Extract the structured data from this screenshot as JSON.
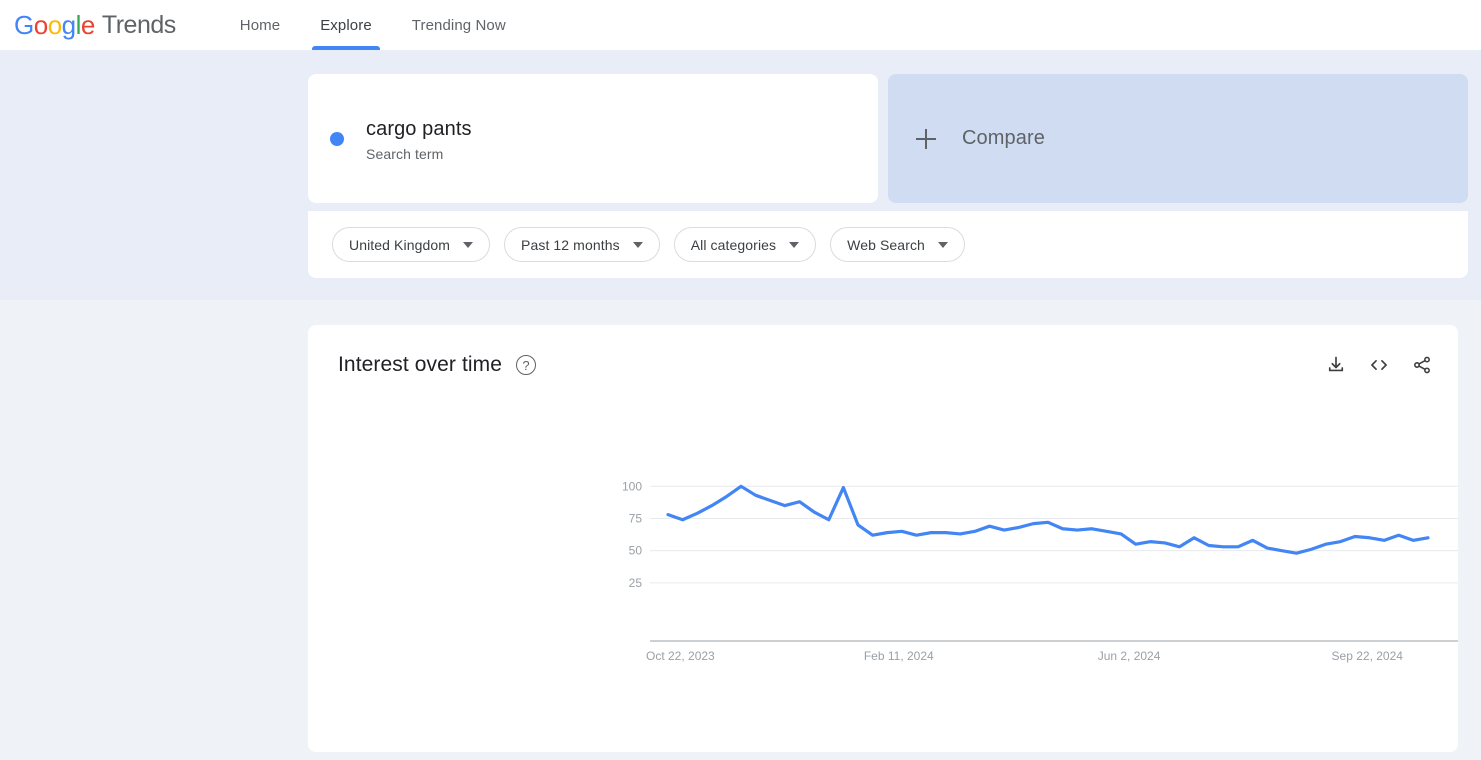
{
  "header": {
    "logo_text": "Google",
    "logo_suffix": "Trends",
    "nav": [
      {
        "label": "Home",
        "active": false
      },
      {
        "label": "Explore",
        "active": true
      },
      {
        "label": "Trending Now",
        "active": false
      }
    ]
  },
  "query": {
    "term": "cargo pants",
    "term_type": "Search term",
    "term_color": "#4285f4",
    "compare_label": "Compare"
  },
  "filters": [
    {
      "label": "United Kingdom"
    },
    {
      "label": "Past 12 months"
    },
    {
      "label": "All categories"
    },
    {
      "label": "Web Search"
    }
  ],
  "chart_card": {
    "title": "Interest over time",
    "help_glyph": "?",
    "actions": [
      {
        "name": "download-icon"
      },
      {
        "name": "embed-icon"
      },
      {
        "name": "share-icon"
      }
    ]
  },
  "chart_data": {
    "type": "line",
    "title": "Interest over time",
    "xlabel": "",
    "ylabel": "",
    "ylim": [
      0,
      108
    ],
    "yticks": [
      25,
      50,
      75,
      100
    ],
    "ytick_labels": [
      "25",
      "50",
      "75",
      "100"
    ],
    "grid": true,
    "legend_position": "none",
    "line_color": "#4285f4",
    "xtick_labels": [
      "Oct 22, 2023",
      "Feb 11, 2024",
      "Jun 2, 2024",
      "Sep 22, 2024"
    ],
    "xtick_indices": [
      0,
      16,
      32,
      48
    ],
    "series": [
      {
        "name": "cargo pants",
        "color": "#4285f4",
        "values": [
          78,
          74,
          79,
          85,
          92,
          100,
          93,
          89,
          85,
          88,
          80,
          74,
          99,
          70,
          62,
          64,
          65,
          62,
          64,
          64,
          63,
          65,
          69,
          66,
          68,
          71,
          72,
          67,
          66,
          67,
          65,
          63,
          55,
          57,
          56,
          53,
          60,
          54,
          53,
          53,
          58,
          52,
          50,
          48,
          51,
          55,
          57,
          61,
          60,
          58,
          62,
          58,
          60
        ]
      }
    ]
  }
}
